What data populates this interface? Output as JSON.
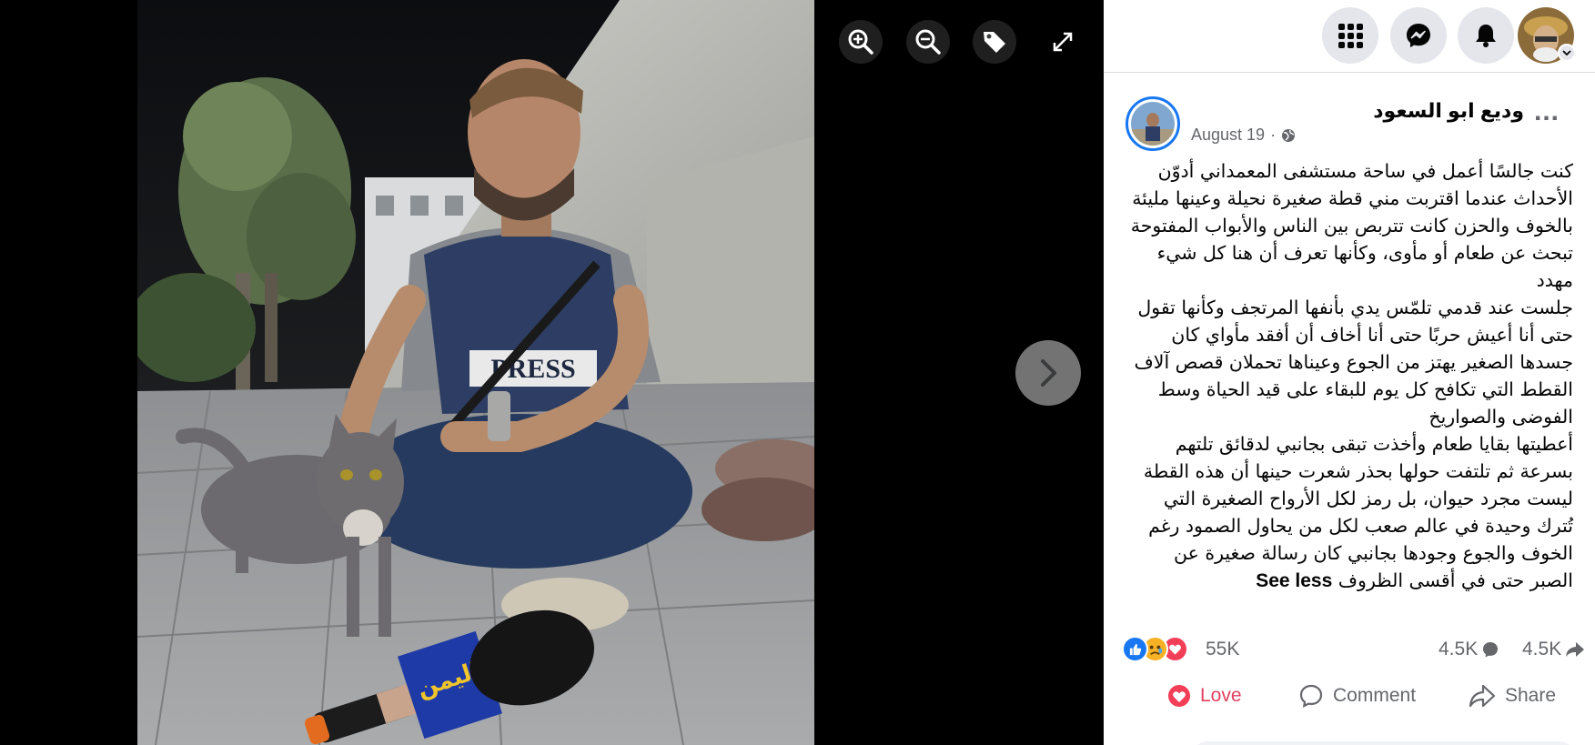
{
  "viewer": {
    "toolbar": [
      {
        "name": "zoom-in",
        "icon": "zoom-in-icon"
      },
      {
        "name": "zoom-out",
        "icon": "zoom-out-icon"
      },
      {
        "name": "tag",
        "icon": "tag-icon"
      },
      {
        "name": "fullscreen",
        "icon": "fullscreen-icon"
      }
    ],
    "next_icon": "chevron-right-icon",
    "photo": {
      "vest_text": "PRESS",
      "mic_text": "اليمن",
      "mic_subtext": "اليمن"
    }
  },
  "topbar": {
    "menu_icon": "grid-menu-icon",
    "messenger_icon": "messenger-icon",
    "notifications_icon": "bell-icon",
    "account_icon": "account-avatar"
  },
  "post": {
    "author": "وديع ابو السعود",
    "date": "August 19",
    "separator": "·",
    "privacy_icon": "globe-icon",
    "more_icon": "more-options-icon",
    "paragraphs": [
      "كنت جالسًا أعمل في ساحة مستشفى المعمداني أدوّن الأحداث عندما اقتربت مني قطة صغيرة نحيلة وعينها مليئة بالخوف والحزن كانت تتربص بين الناس والأبواب المفتوحة تبحث عن طعام أو مأوى، وكأنها تعرف أن هنا كل شيء مهدد",
      "جلست عند قدمي تلمّس يدي بأنفها المرتجف وكأنها تقول حتى أنا أعيش حربًا حتى أنا أخاف أن أفقد مأواي كان جسدها الصغير يهتز من الجوع وعيناها تحملان قصص آلاف القطط التي تكافح كل يوم للبقاء على قيد الحياة وسط الفوضى والصواريخ",
      "أعطيتها بقايا طعام وأخذت تبقى بجانبي لدقائق تلتهم بسرعة ثم تلتفت حولها بحذر شعرت حينها أن هذه القطة ليست مجرد حيوان، بل رمز لكل الأرواح الصغيرة التي تُترك وحيدة في عالم صعب لكل من يحاول الصمود رغم الخوف والجوع وجودها بجانبي كان رسالة صغيرة عن الصبر حتى في أقسى الظروف"
    ],
    "see_less": "See less"
  },
  "stats": {
    "reactions": "55K",
    "reaction_icons": [
      "like-icon",
      "sad-icon",
      "love-icon"
    ],
    "comments": "4.5K",
    "shares": "4.5K"
  },
  "actions": {
    "love": "Love",
    "comment": "Comment",
    "share": "Share"
  },
  "colors": {
    "facebook_blue": "#1877f2",
    "love_red": "#e4405f",
    "muted_text": "#65676b",
    "button_bg": "#e4e6eb"
  }
}
